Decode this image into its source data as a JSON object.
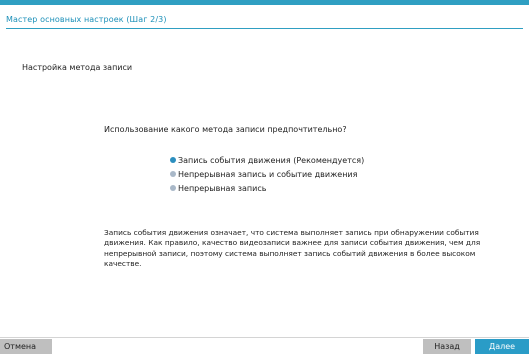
{
  "header": {
    "title": "Мастер основных настроек (Шаг 2/3)"
  },
  "main": {
    "section_title": "Настройка метода записи",
    "question": "Использование какого метода записи предпочтительно?",
    "options": [
      {
        "label": "Запись события движения (Рекомендуется)",
        "selected": true
      },
      {
        "label": "Непрерывная запись и событие движения",
        "selected": false
      },
      {
        "label": "Непрерывная запись",
        "selected": false
      }
    ],
    "description": "Запись события движения означает, что система выполняет запись при обнаружении события движения. Как правило, качество видеозаписи важнее для записи события движения, чем для непрерывной записи, поэтому система выполняет запись событий движения в более высоком качестве."
  },
  "footer": {
    "cancel_label": "Отмена",
    "back_label": "Назад",
    "next_label": "Далее"
  },
  "colors": {
    "accent": "#2f9fc2",
    "next_button": "#2a9cc7",
    "secondary_button": "#bfbfbf"
  }
}
